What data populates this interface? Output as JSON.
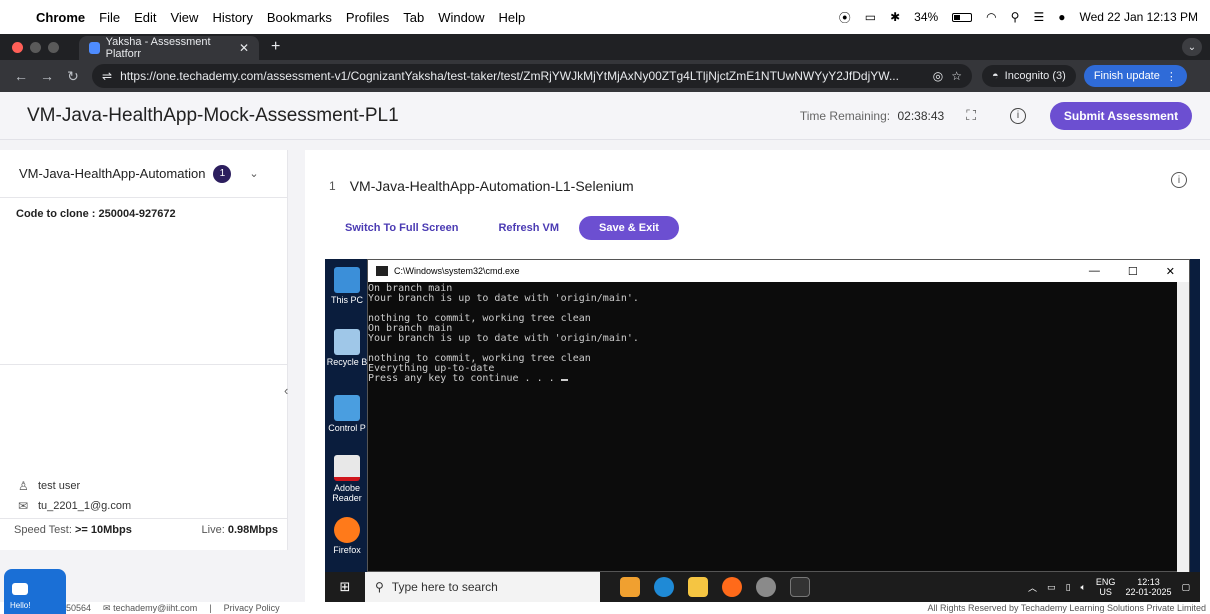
{
  "menubar": {
    "app": "Chrome",
    "items": [
      "File",
      "Edit",
      "View",
      "History",
      "Bookmarks",
      "Profiles",
      "Tab",
      "Window",
      "Help"
    ],
    "battery": "34%",
    "datetime": "Wed 22 Jan 12:13 PM"
  },
  "browser": {
    "tab_title": "Yaksha - Assessment Platforr",
    "url": "https://one.techademy.com/assessment-v1/CognizantYaksha/test-taker/test/ZmRjYWJkMjYtMjAxNy00ZTg4LTljNjctZmE1NTUwNWYyY2JfDdjYW...",
    "incognito_label": "Incognito (3)",
    "update_label": "Finish update"
  },
  "header": {
    "title": "VM-Java-HealthApp-Mock-Assessment-PL1",
    "time_label": "Time Remaining:",
    "time_value": "02:38:43",
    "submit_label": "Submit Assessment"
  },
  "sidebar": {
    "section_title": "VM-Java-HealthApp-Automation",
    "section_count": "1",
    "clone_text": "Code to clone : 250004-927672",
    "user_name": "test user",
    "user_email": "tu_2201_1@g.com",
    "speed_label": "Speed Test:",
    "speed_value": ">= 10Mbps",
    "live_label": "Live:",
    "live_value": "0.98Mbps"
  },
  "question": {
    "number": "1",
    "title": "VM-Java-HealthApp-Automation-L1-Selenium",
    "fullscreen_label": "Switch To Full Screen",
    "refresh_label": "Refresh VM",
    "save_label": "Save & Exit"
  },
  "vm": {
    "desktop_icons": [
      "This PC",
      "Recycle B",
      "Control P",
      "Adobe Reader",
      "Firefox"
    ],
    "cmd_title": "C:\\Windows\\system32\\cmd.exe",
    "cmd_lines": [
      "On branch main",
      "Your branch is up to date with 'origin/main'.",
      "",
      "nothing to commit, working tree clean",
      "On branch main",
      "Your branch is up to date with 'origin/main'.",
      "",
      "nothing to commit, working tree clean",
      "Everything up-to-date",
      "Press any key to continue . . . "
    ],
    "search_placeholder": "Type here to search",
    "tray_lang_top": "ENG",
    "tray_lang_bottom": "US",
    "tray_time": "12:13",
    "tray_date": "22-01-2025"
  },
  "footer": {
    "phone_partial": "50564",
    "email": "techademy@iiht.com",
    "privacy": "Privacy Policy",
    "rights": "All Rights Reserved by Techademy Learning Solutions Private Limited",
    "hello": "Hello!"
  },
  "colors": {
    "accent": "#6c4fd1",
    "badge": "#2c1e5e",
    "link": "#4b3bb3"
  }
}
